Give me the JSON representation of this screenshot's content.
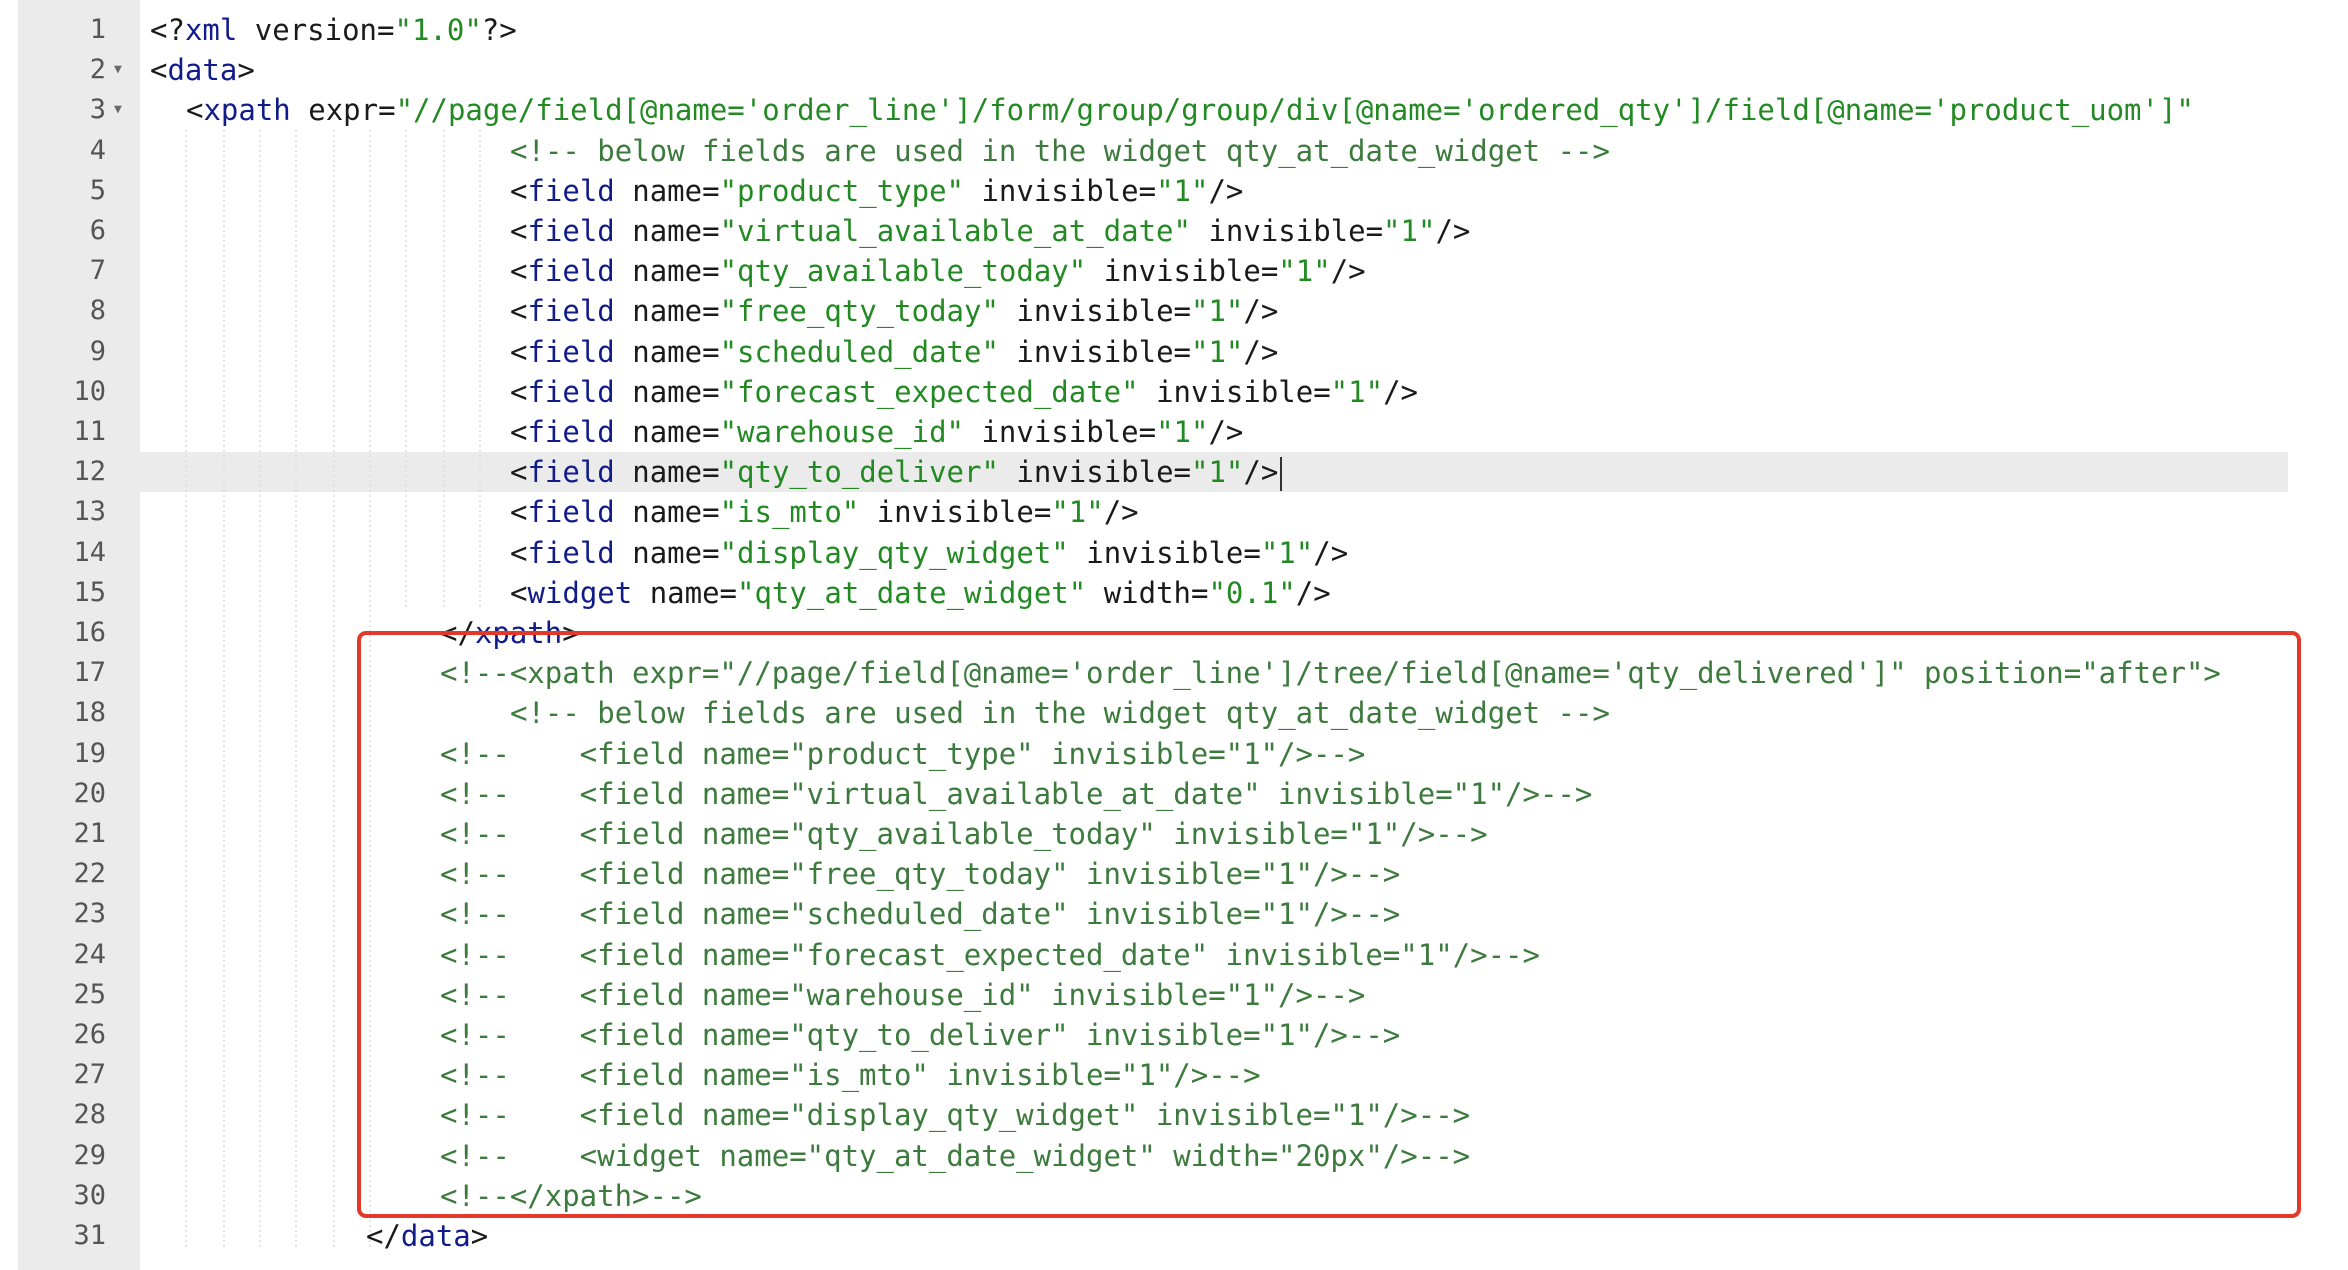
{
  "editor": {
    "lines": [
      {
        "n": "1",
        "fold": "",
        "html": "<span class=\"punct\">&lt;?</span><span class=\"tag\">xml</span><span class=\"attr\"> version</span><span class=\"punct\">=</span><span class=\"str\">\"1.0\"</span><span class=\"punct\">?&gt;</span>",
        "text": "<?xml version=\"1.0\"?>"
      },
      {
        "n": "2",
        "fold": "▼",
        "text": "<data>"
      },
      {
        "n": "3",
        "fold": "▼",
        "text": "<xpath expr=\"//page/field[@name='order_line']/form/group/group/div[@name='ordered_qty']/field[@name='product_uom']\""
      },
      {
        "n": "4",
        "fold": "",
        "text": "<!-- below fields are used in the widget qty_at_date_widget -->"
      },
      {
        "n": "5",
        "fold": "",
        "text": "<field name=\"product_type\" invisible=\"1\"/>"
      },
      {
        "n": "6",
        "fold": "",
        "text": "<field name=\"virtual_available_at_date\" invisible=\"1\"/>"
      },
      {
        "n": "7",
        "fold": "",
        "text": "<field name=\"qty_available_today\" invisible=\"1\"/>"
      },
      {
        "n": "8",
        "fold": "",
        "text": "<field name=\"free_qty_today\" invisible=\"1\"/>"
      },
      {
        "n": "9",
        "fold": "",
        "text": "<field name=\"scheduled_date\" invisible=\"1\"/>"
      },
      {
        "n": "10",
        "fold": "",
        "text": "<field name=\"forecast_expected_date\" invisible=\"1\"/>"
      },
      {
        "n": "11",
        "fold": "",
        "text": "<field name=\"warehouse_id\" invisible=\"1\"/>"
      },
      {
        "n": "12",
        "fold": "",
        "text": "<field name=\"qty_to_deliver\" invisible=\"1\"/>"
      },
      {
        "n": "13",
        "fold": "",
        "text": "<field name=\"is_mto\" invisible=\"1\"/>"
      },
      {
        "n": "14",
        "fold": "",
        "text": "<field name=\"display_qty_widget\" invisible=\"1\"/>"
      },
      {
        "n": "15",
        "fold": "",
        "text": "<widget name=\"qty_at_date_widget\" width=\"0.1\"/>"
      },
      {
        "n": "16",
        "fold": "",
        "text": "</xpath>"
      },
      {
        "n": "17",
        "fold": "",
        "text": "<!--<xpath expr=\"//page/field[@name='order_line']/tree/field[@name='qty_delivered']\" position=\"after\">"
      },
      {
        "n": "18",
        "fold": "",
        "text": "<!-- below fields are used in the widget qty_at_date_widget -->"
      },
      {
        "n": "19",
        "fold": "",
        "text": "<!--    <field name=\"product_type\" invisible=\"1\"/>-->"
      },
      {
        "n": "20",
        "fold": "",
        "text": "<!--    <field name=\"virtual_available_at_date\" invisible=\"1\"/>-->"
      },
      {
        "n": "21",
        "fold": "",
        "text": "<!--    <field name=\"qty_available_today\" invisible=\"1\"/>-->"
      },
      {
        "n": "22",
        "fold": "",
        "text": "<!--    <field name=\"free_qty_today\" invisible=\"1\"/>-->"
      },
      {
        "n": "23",
        "fold": "",
        "text": "<!--    <field name=\"scheduled_date\" invisible=\"1\"/>-->"
      },
      {
        "n": "24",
        "fold": "",
        "text": "<!--    <field name=\"forecast_expected_date\" invisible=\"1\"/>-->"
      },
      {
        "n": "25",
        "fold": "",
        "text": "<!--    <field name=\"warehouse_id\" invisible=\"1\"/>-->"
      },
      {
        "n": "26",
        "fold": "",
        "text": "<!--    <field name=\"qty_to_deliver\" invisible=\"1\"/>-->"
      },
      {
        "n": "27",
        "fold": "",
        "text": "<!--    <field name=\"is_mto\" invisible=\"1\"/>-->"
      },
      {
        "n": "28",
        "fold": "",
        "text": "<!--    <field name=\"display_qty_widget\" invisible=\"1\"/>-->"
      },
      {
        "n": "29",
        "fold": "",
        "text": "<!--    <widget name=\"qty_at_date_widget\" width=\"20px\"/>-->"
      },
      {
        "n": "30",
        "fold": "",
        "text": "<!--</xpath>-->"
      },
      {
        "n": "31",
        "fold": "",
        "text": "</data>"
      }
    ],
    "active_line": "12",
    "colors": {
      "tag": "#111c8a",
      "string": "#238a23",
      "comment": "#3d7a3d",
      "gutter": "#ebebeb",
      "highlight_box": "#e2392b"
    }
  }
}
